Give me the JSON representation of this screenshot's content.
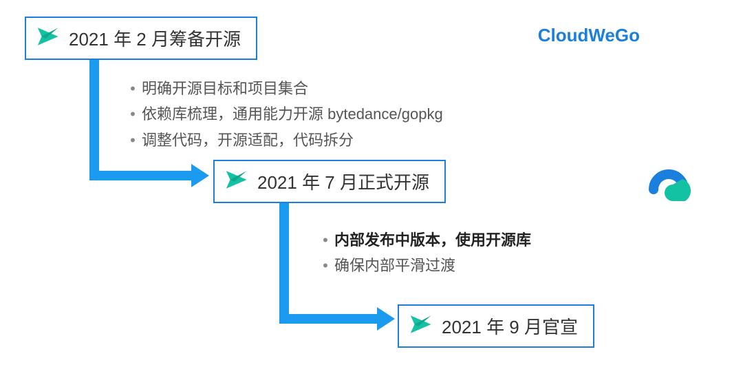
{
  "brand": "CloudWeGo",
  "colors": {
    "primary": "#1b7fde",
    "connector": "#1b9bf0",
    "accent": "#13c2a3"
  },
  "milestones": [
    {
      "title": "2021 年 2 月筹备开源",
      "bullets": [
        {
          "text": "明确开源目标和项目集合",
          "bold": false
        },
        {
          "text": "依赖库梳理，通用能力开源 bytedance/gopkg",
          "bold": false
        },
        {
          "text": "调整代码，开源适配，代码拆分",
          "bold": false
        }
      ]
    },
    {
      "title": "2021 年 7 月正式开源",
      "bullets": [
        {
          "text": "内部发布中版本，使用开源库",
          "bold": true
        },
        {
          "text": "确保内部平滑过渡",
          "bold": false
        }
      ]
    },
    {
      "title": "2021 年 9 月官宣",
      "bullets": []
    }
  ]
}
